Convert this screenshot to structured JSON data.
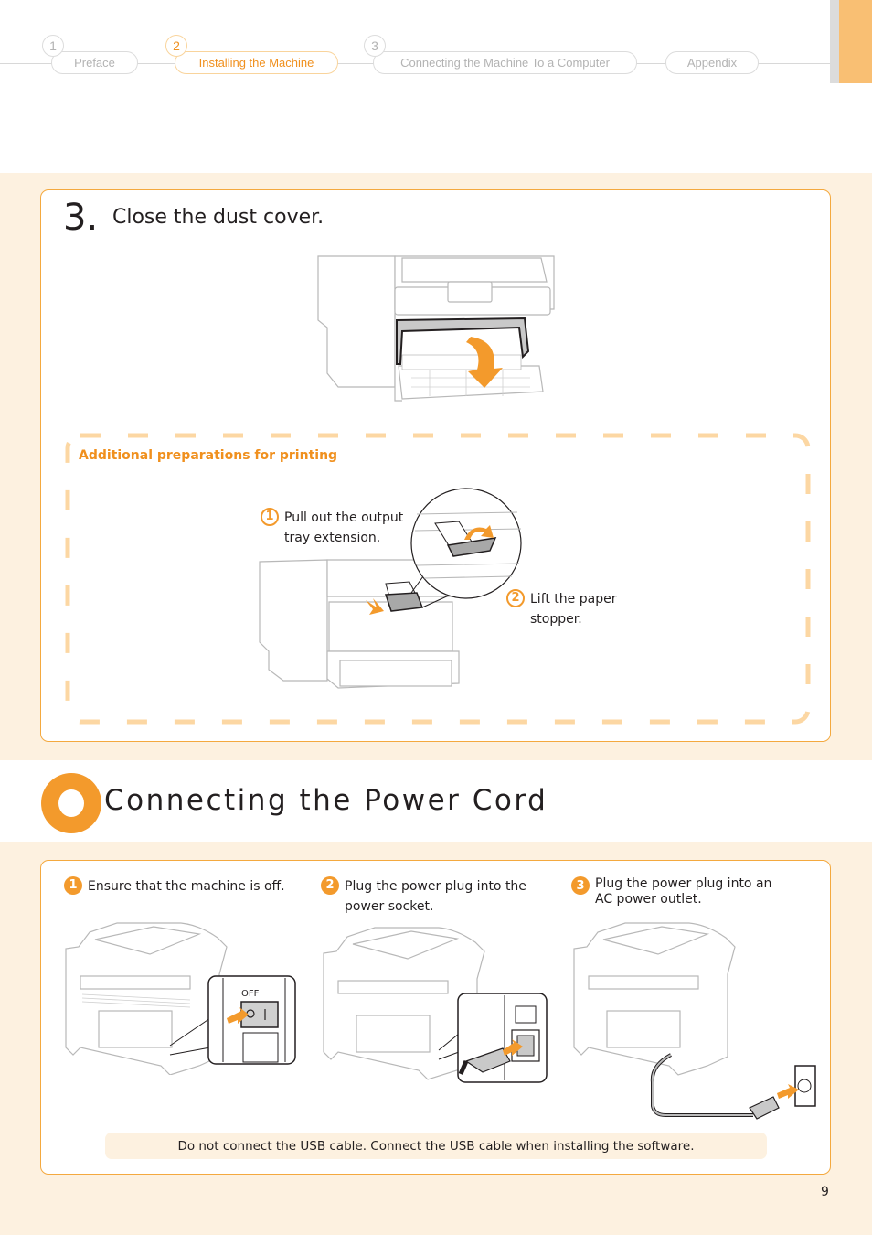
{
  "nav": {
    "items": [
      {
        "num": "1",
        "label": "Preface",
        "active": false
      },
      {
        "num": "2",
        "label": "Installing the Machine",
        "active": true
      },
      {
        "num": "3",
        "label": "Connecting the Machine To a Computer",
        "active": false
      },
      {
        "num": "",
        "label": "Appendix",
        "active": false
      }
    ]
  },
  "step3": {
    "number": "3.",
    "title": "Close the dust cover."
  },
  "additional": {
    "title": "Additional preparations for printing",
    "steps": [
      {
        "num": "1",
        "text_line1": "Pull out the output",
        "text_line2": "tray extension."
      },
      {
        "num": "2",
        "text_line1": "Lift the paper",
        "text_line2": "stopper."
      }
    ]
  },
  "power_section": {
    "title": "Connecting the Power Cord",
    "steps": [
      {
        "num": "1",
        "text_line1": "Ensure that the machine is off.",
        "text_line2": ""
      },
      {
        "num": "2",
        "text_line1": "Plug the power plug into the",
        "text_line2": "power socket."
      },
      {
        "num": "3",
        "text_line1": "Plug the power plug into an",
        "text_line2": "AC power outlet."
      }
    ],
    "switch_label": "OFF",
    "note": "Do not connect the USB cable. Connect the USB cable when installing the software."
  },
  "page_number": "9",
  "colors": {
    "accent": "#f39a2c",
    "accent_light": "#f9d49c",
    "cream": "#fdf1e0",
    "text": "#231f20"
  }
}
